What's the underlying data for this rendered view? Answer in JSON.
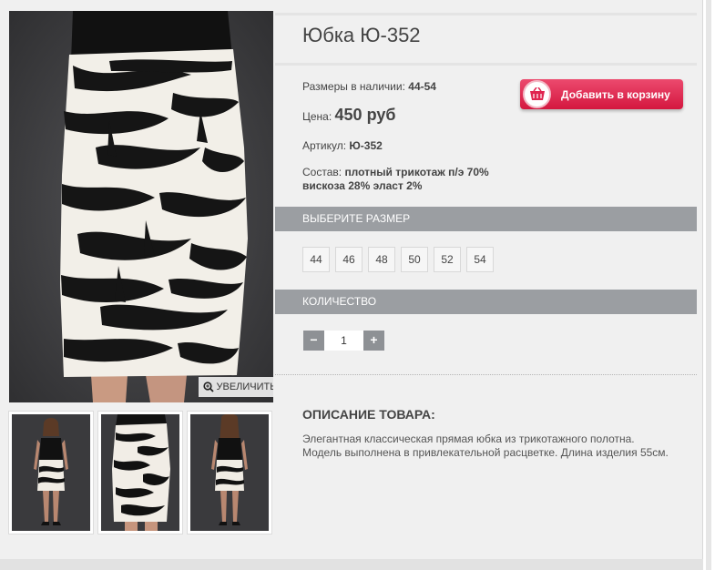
{
  "product": {
    "title": "Юбка Ю-352",
    "sizes_label": "Размеры в наличии:",
    "sizes_value": "44-54",
    "price_label": "Цена:",
    "price_value": "450 руб",
    "article_label": "Артикул:",
    "article_value": "Ю-352",
    "composition_label": "Состав:",
    "composition_value_line1": "плотный трикотаж п/э 70%",
    "composition_value_line2": "вискоза 28% эласт 2%"
  },
  "cart_button": {
    "label": "Добавить в корзину",
    "icon": "basket-icon"
  },
  "gallery": {
    "zoom_label": "УВЕЛИЧИТЬ",
    "zoom_icon": "magnifier-icon"
  },
  "size_section": {
    "header": "ВЫБЕРИТЕ РАЗМЕР",
    "sizes": [
      "44",
      "46",
      "48",
      "50",
      "52",
      "54"
    ]
  },
  "quantity_section": {
    "header": "КОЛИЧЕСТВО",
    "minus_label": "−",
    "plus_label": "+",
    "value": "1"
  },
  "description": {
    "title": "ОПИСАНИЕ ТОВАРА:",
    "text": "Элегантная классическая прямая юбка из трикотажного полотна. Модель выполнена в привлекательной расцветке. Длина изделия 55см."
  },
  "colors": {
    "accent": "#e0244f",
    "section_bar": "#9b9ea2",
    "panel_bg": "#f0f0f0"
  }
}
